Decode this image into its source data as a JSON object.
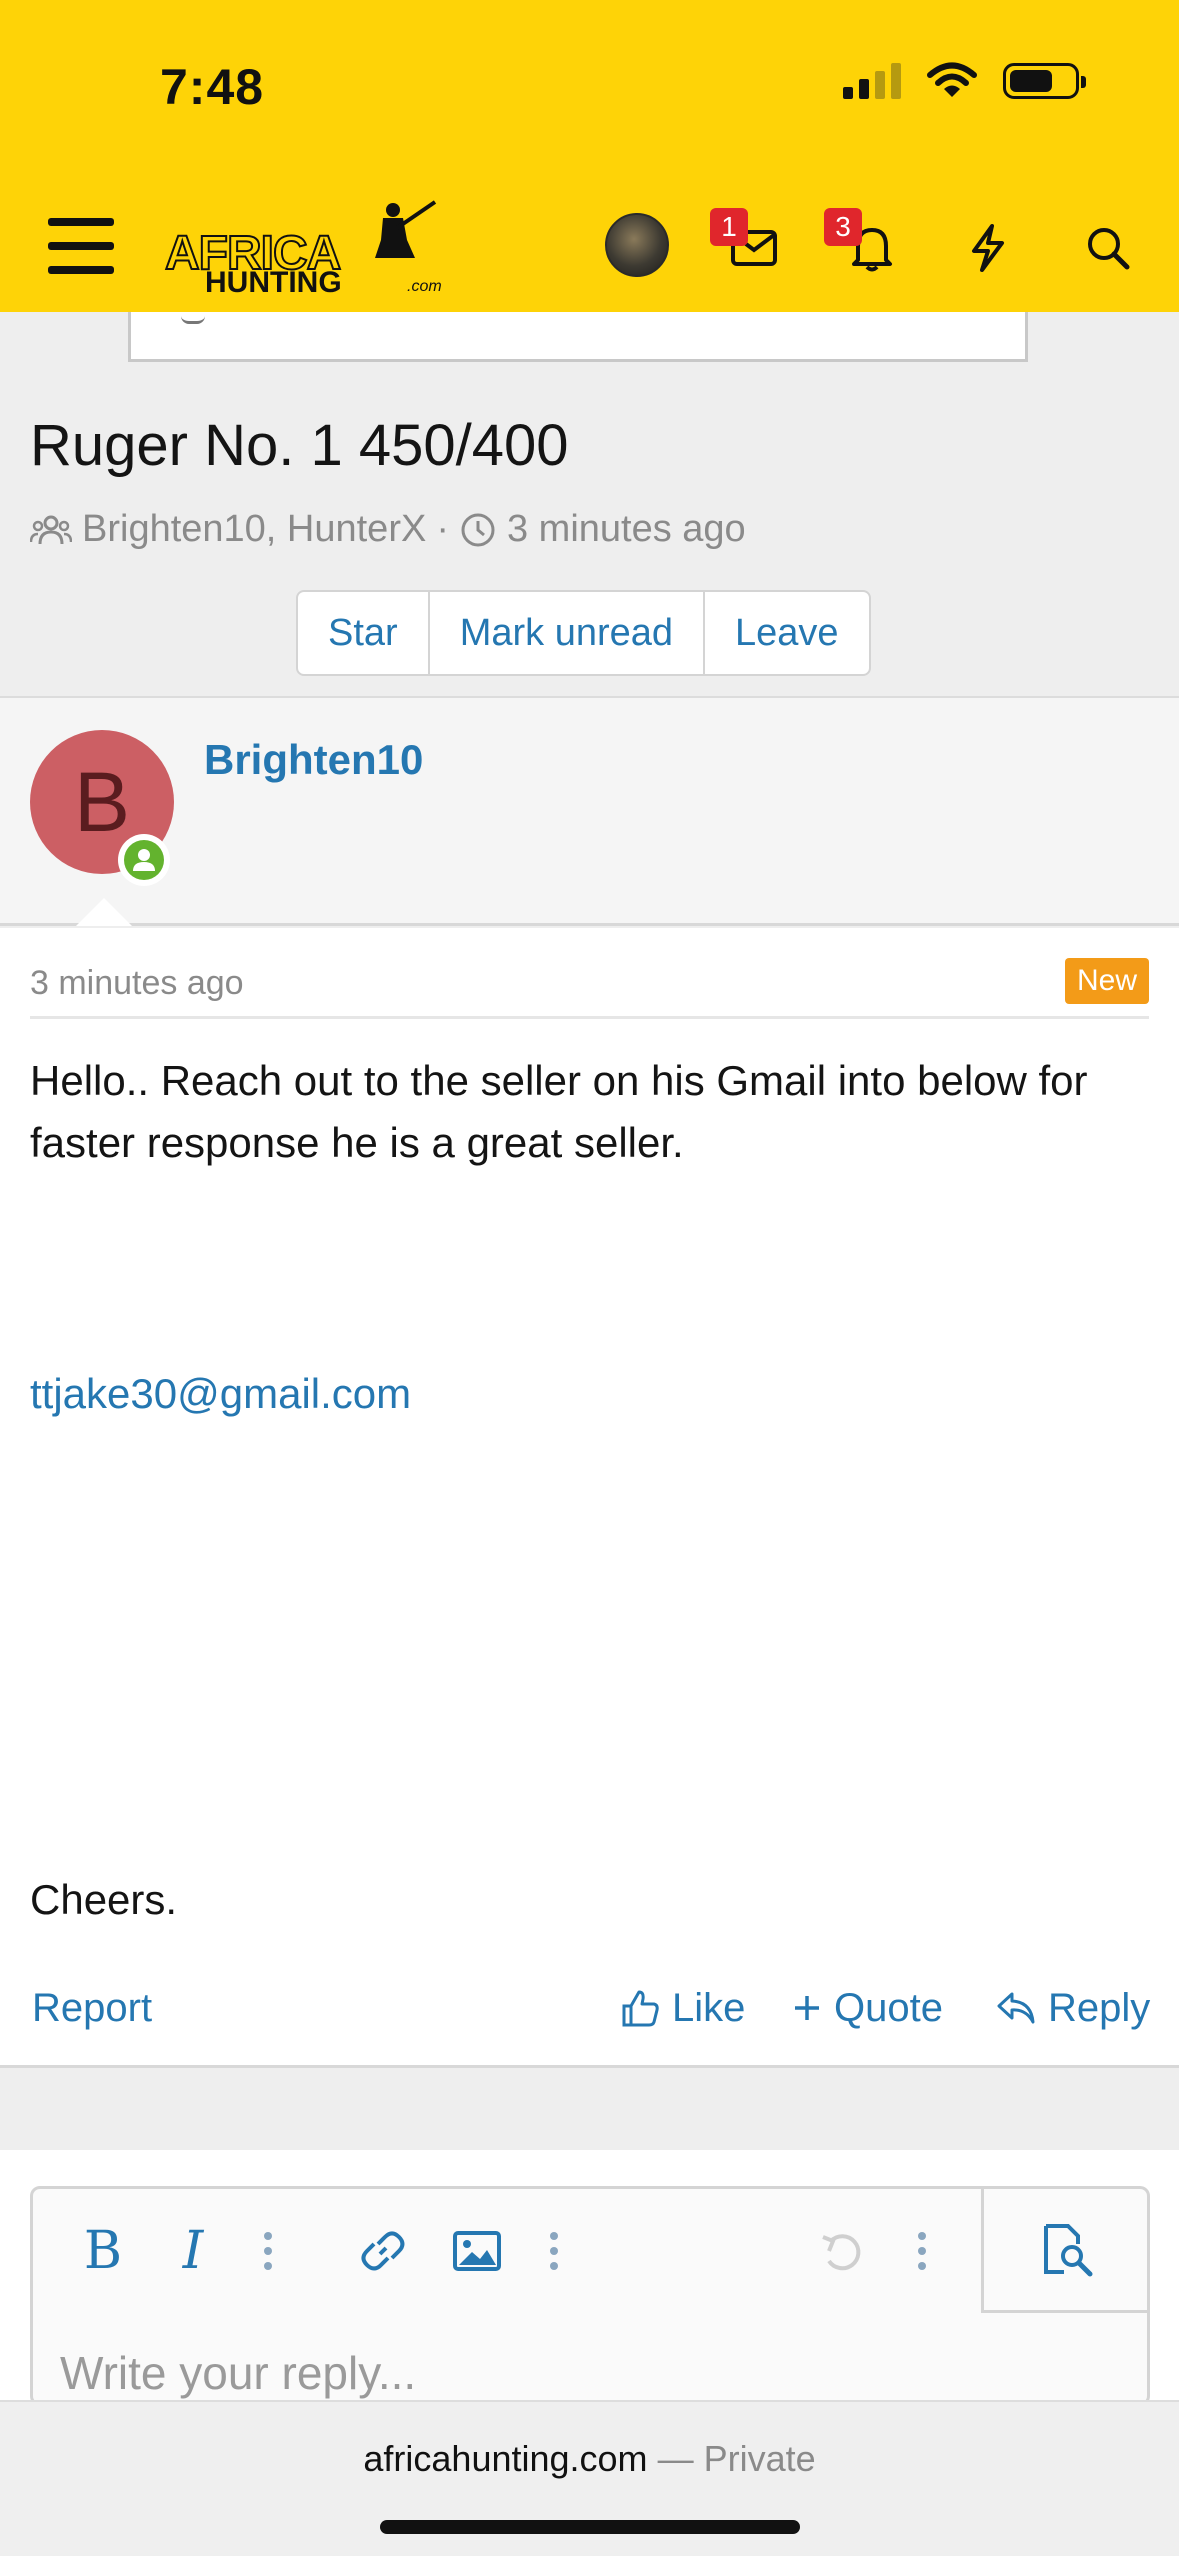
{
  "status_bar": {
    "time": "7:48"
  },
  "header": {
    "logo_line1": "AFRICA",
    "logo_line2": "HUNTING",
    "logo_suffix": ".com",
    "inbox_badge": "1",
    "alerts_badge": "3"
  },
  "thread": {
    "title": "Ruger No. 1 450/400",
    "participants": "Brighten10, HunterX",
    "separator": "·",
    "time": "3 minutes ago",
    "buttons": {
      "star": "Star",
      "mark_unread": "Mark unread",
      "leave": "Leave"
    }
  },
  "post": {
    "author_initial": "B",
    "author": "Brighten10",
    "time": "3 minutes ago",
    "new_badge": "New",
    "body": "Hello.. Reach out to the seller on his Gmail into below for faster response he is a great seller.",
    "email": "ttjake30@gmail.com",
    "closing": "Cheers.",
    "actions": {
      "report": "Report",
      "like": "Like",
      "quote": "Quote",
      "reply": "Reply"
    }
  },
  "editor": {
    "placeholder": "Write your reply..."
  },
  "browser": {
    "domain": "africahunting.com",
    "mode": "— Private"
  },
  "colors": {
    "header_bg": "#fed307",
    "link": "#2577b1",
    "new_badge": "#f39b18",
    "avatar": "#cc5f64",
    "online": "#63b32e"
  }
}
